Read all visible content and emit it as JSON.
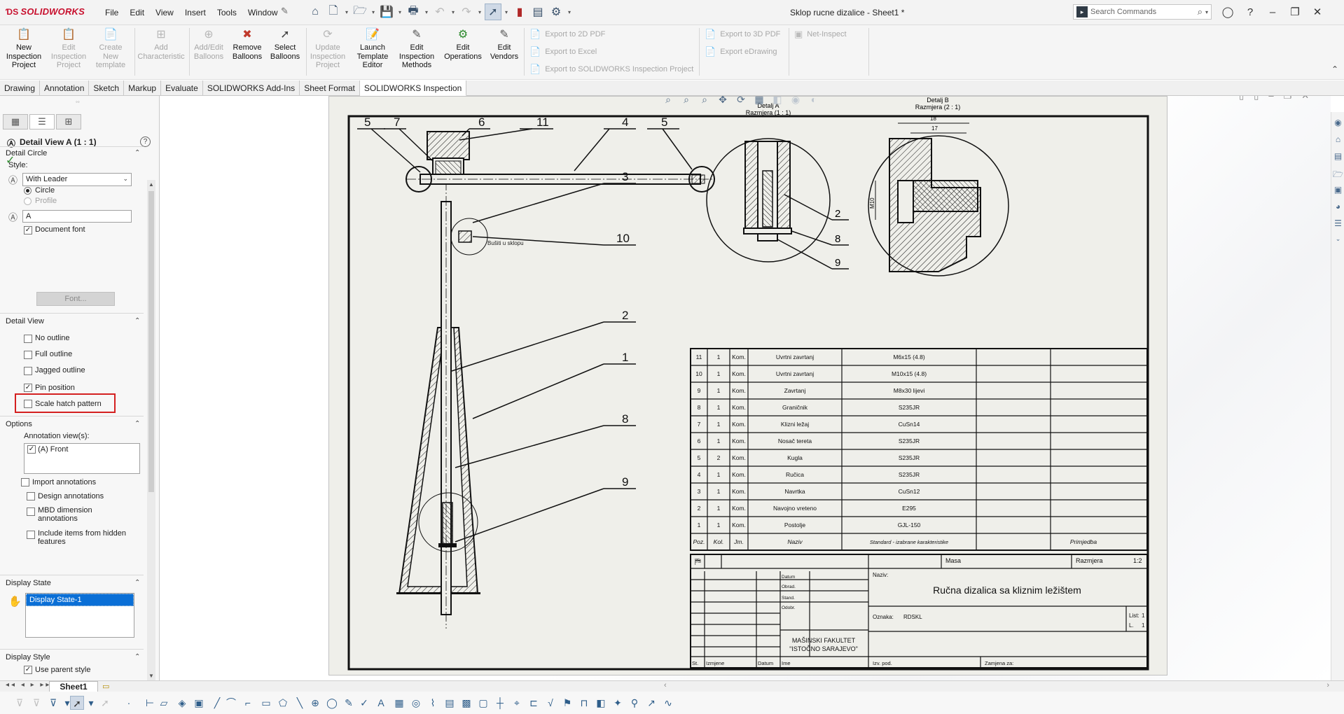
{
  "app": {
    "logo": "SOLIDWORKS",
    "doc_title": "Sklop rucne dizalice - Sheet1 *",
    "menu": [
      "File",
      "Edit",
      "View",
      "Insert",
      "Tools",
      "Window"
    ],
    "search_placeholder": "Search Commands"
  },
  "command_manager": {
    "buttons": [
      {
        "label": "New Inspection Project",
        "lines": [
          "New",
          "Inspection",
          "Project"
        ],
        "enabled": true
      },
      {
        "label": "Edit Inspection Project",
        "lines": [
          "Edit",
          "Inspection",
          "Project"
        ],
        "enabled": false
      },
      {
        "label": "Create New template",
        "lines": [
          "Create",
          "New",
          "template"
        ],
        "enabled": false
      },
      {
        "label": "Add Characteristic",
        "lines": [
          "Add",
          "Characteristic"
        ],
        "enabled": false
      },
      {
        "label": "Add/Edit Balloons",
        "lines": [
          "Add/Edit",
          "Balloons"
        ],
        "enabled": false
      },
      {
        "label": "Remove Balloons",
        "lines": [
          "Remove",
          "Balloons"
        ],
        "enabled": true
      },
      {
        "label": "Select Balloons",
        "lines": [
          "Select",
          "Balloons"
        ],
        "enabled": true
      },
      {
        "label": "Update Inspection Project",
        "lines": [
          "Update",
          "Inspection",
          "Project"
        ],
        "enabled": false
      },
      {
        "label": "Launch Template Editor",
        "lines": [
          "Launch",
          "Template",
          "Editor"
        ],
        "enabled": true
      },
      {
        "label": "Edit Inspection Methods",
        "lines": [
          "Edit",
          "Inspection",
          "Methods"
        ],
        "enabled": true
      },
      {
        "label": "Edit Operations",
        "lines": [
          "Edit",
          "Operations"
        ],
        "enabled": true
      },
      {
        "label": "Edit Vendors",
        "lines": [
          "Edit",
          "Vendors"
        ],
        "enabled": true
      }
    ],
    "export": {
      "pdf2d": "Export to 2D PDF",
      "excel": "Export to Excel",
      "inspection_project": "Export to SOLIDWORKS Inspection Project",
      "pdf3d": "Export to 3D PDF",
      "edrawing": "Export eDrawing",
      "net_inspect": "Net-Inspect"
    }
  },
  "tabs": [
    "Drawing",
    "Annotation",
    "Sketch",
    "Markup",
    "Evaluate",
    "SOLIDWORKS Add-Ins",
    "Sheet Format",
    "SOLIDWORKS Inspection"
  ],
  "active_tab": "SOLIDWORKS Inspection",
  "property_manager": {
    "title": "Detail View A (1 : 1)",
    "detail_circle": {
      "header": "Detail Circle",
      "style_label": "Style:",
      "style_value": "With Leader",
      "circle_label": "Circle",
      "profile_label": "Profile",
      "label_value": "A",
      "document_font_label": "Document font",
      "document_font_checked": true,
      "font_button": "Font..."
    },
    "detail_view": {
      "header": "Detail View",
      "items": [
        {
          "label": "No outline",
          "checked": false
        },
        {
          "label": "Full outline",
          "checked": false
        },
        {
          "label": "Jagged outline",
          "checked": false
        },
        {
          "label": "Pin position",
          "checked": true
        },
        {
          "label": "Scale hatch pattern",
          "checked": false
        }
      ]
    },
    "options": {
      "header": "Options",
      "annotation_views_label": "Annotation view(s):",
      "annotation_view_item": "(A) Front",
      "import_annotations": "Import annotations",
      "design_annotations": "Design annotations",
      "mbd_dimension": [
        "MBD dimension",
        "annotations"
      ],
      "include_hidden": [
        "Include items from hidden",
        "features"
      ]
    },
    "display_state": {
      "header": "Display State",
      "item": "Display State-1"
    },
    "display_style": {
      "header": "Display Style",
      "use_parent_style": "Use parent style"
    }
  },
  "sheet_tab": "Sheet1",
  "drawing": {
    "detail_a_title": [
      "Detalj A",
      "Razmjera (1 : 1)"
    ],
    "detail_b_title": [
      "Detalj B",
      "Razmjera (2 : 1)"
    ],
    "note": "Bušiti u sklopu",
    "balloons_front": [
      "5",
      "7",
      "6",
      "11",
      "4",
      "5",
      "3",
      "10",
      "2",
      "1",
      "8",
      "9"
    ],
    "balloons_detail_a": [
      "2",
      "8",
      "9"
    ],
    "dims_b": [
      "18",
      "17",
      "M10"
    ],
    "bom": [
      {
        "poz": "11",
        "kol": "1",
        "jm": "Kom.",
        "naziv": "Uvrtni zavrtanj",
        "standard": "M6x15 (4.8)",
        "napomena": ""
      },
      {
        "poz": "10",
        "kol": "1",
        "jm": "Kom.",
        "naziv": "Uvrtni zavrtanj",
        "standard": "M10x15 (4.8)",
        "napomena": ""
      },
      {
        "poz": "9",
        "kol": "1",
        "jm": "Kom.",
        "naziv": "Zavrtanj",
        "standard": "M8x30 lijevi",
        "napomena": ""
      },
      {
        "poz": "8",
        "kol": "1",
        "jm": "Kom.",
        "naziv": "Graničnik",
        "standard": "S235JR",
        "napomena": ""
      },
      {
        "poz": "7",
        "kol": "1",
        "jm": "Kom.",
        "naziv": "Klizni ležaj",
        "standard": "CuSn14",
        "napomena": ""
      },
      {
        "poz": "6",
        "kol": "1",
        "jm": "Kom.",
        "naziv": "Nosač tereta",
        "standard": "S235JR",
        "napomena": ""
      },
      {
        "poz": "5",
        "kol": "2",
        "jm": "Kom.",
        "naziv": "Kugla",
        "standard": "S235JR",
        "napomena": ""
      },
      {
        "poz": "4",
        "kol": "1",
        "jm": "Kom.",
        "naziv": "Ručica",
        "standard": "S235JR",
        "napomena": ""
      },
      {
        "poz": "3",
        "kol": "1",
        "jm": "Kom.",
        "naziv": "Navrtka",
        "standard": "CuSn12",
        "napomena": ""
      },
      {
        "poz": "2",
        "kol": "1",
        "jm": "Kom.",
        "naziv": "Navojno vreteno",
        "standard": "E295",
        "napomena": ""
      },
      {
        "poz": "1",
        "kol": "1",
        "jm": "Kom.",
        "naziv": "Postolje",
        "standard": "GJL-150",
        "napomena": ""
      }
    ],
    "bom_header": {
      "poz": "Poz.",
      "kol": "Kol.",
      "jm": "Jm.",
      "naziv": "Naziv",
      "standard": "Standard - izabrane karakteristike",
      "napomena": "Primjedba"
    },
    "title_block": {
      "masa": "Masa",
      "razmjera_label": "Razmjera",
      "razmjera_value": "1:2",
      "naziv_label": "Naziv:",
      "naziv_value": "Ručna dizalica sa kliznim ležištem",
      "datum": "Datum",
      "obrad": "Obrad.",
      "stand": "Stand.",
      "odobr": "Odobr.",
      "faculty_line1": "MAŠINSKI FAKULTET",
      "faculty_line2": "\"ISTOČNO SARAJEVO\"",
      "oznaka_label": "Oznaka:",
      "oznaka_value": "RDSKL",
      "list_label": "List:",
      "list_value": "1",
      "listova_label": "L.",
      "listova_value": "1",
      "st": "St.",
      "izmjene": "Izmjene",
      "datum2": "Datum",
      "ime": "Ime",
      "izv_pod": "Izv. pod.",
      "zamjena": "Zamjena za:"
    }
  }
}
